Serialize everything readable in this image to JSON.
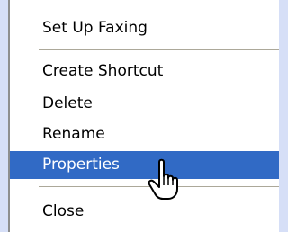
{
  "menu": {
    "items": [
      {
        "label": "Set Up Faxing"
      },
      {
        "label": "Create Shortcut"
      },
      {
        "label": "Delete"
      },
      {
        "label": "Rename"
      },
      {
        "label": "Properties",
        "selected": true
      },
      {
        "label": "Close"
      }
    ]
  },
  "colors": {
    "desktop": "#d6dff7",
    "menu_bg": "#ffffff",
    "highlight": "#316ac5",
    "highlight_text": "#ffffff",
    "separator": "#aca899"
  },
  "cursor": {
    "icon": "hand-pointer-icon"
  }
}
